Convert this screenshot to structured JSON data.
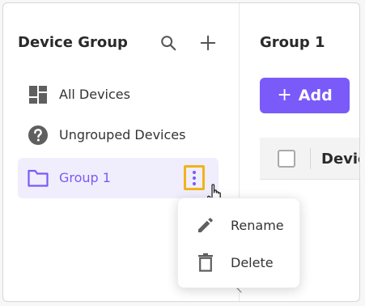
{
  "sidebar": {
    "title": "Device Group",
    "items": [
      {
        "label": "All Devices",
        "icon": "dashboard-icon"
      },
      {
        "label": "Ungrouped Devices",
        "icon": "help-circle-icon"
      },
      {
        "label": "Group 1",
        "icon": "folder-icon",
        "active": true
      }
    ]
  },
  "context_menu": {
    "items": [
      {
        "label": "Rename",
        "icon": "pencil-icon"
      },
      {
        "label": "Delete",
        "icon": "trash-icon"
      }
    ]
  },
  "main": {
    "title": "Group 1",
    "add_button": {
      "label": "Add"
    },
    "table": {
      "columns": [
        "Device"
      ]
    }
  },
  "colors": {
    "accent": "#7a5af8",
    "active_bg": "#f0eefd",
    "highlight": "#f1b21c"
  }
}
